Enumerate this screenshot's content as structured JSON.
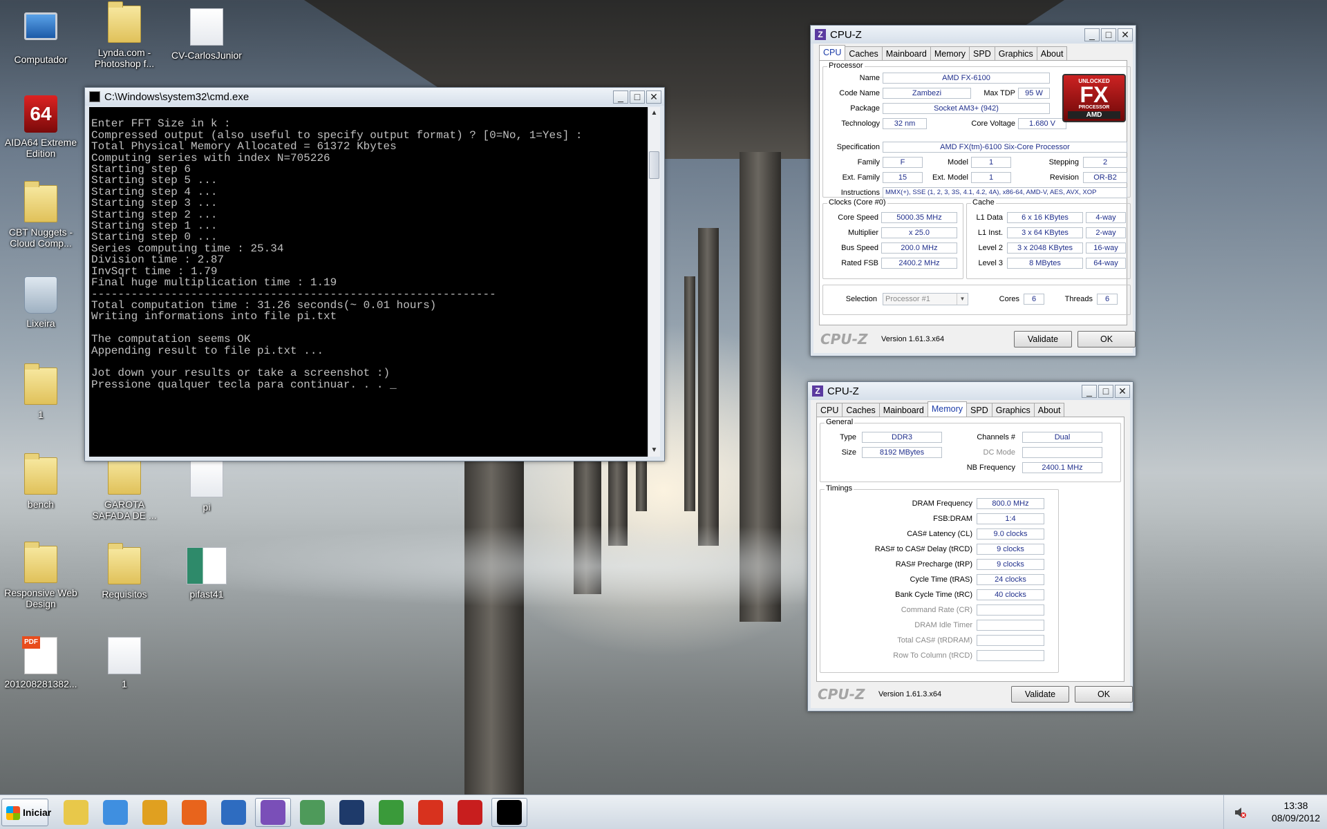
{
  "desktop": {
    "icons": [
      {
        "label": "Computador"
      },
      {
        "label": "Lynda.com - Photoshop f..."
      },
      {
        "label": "CV-CarlosJunior"
      },
      {
        "label": "AIDA64 Extreme Edition"
      },
      {
        "label": "CBT Nuggets - Cloud Comp..."
      },
      {
        "label": "Lixeira"
      },
      {
        "label": "1"
      },
      {
        "label": "bench"
      },
      {
        "label": "GAROTA SAFADA DE ..."
      },
      {
        "label": "pi"
      },
      {
        "label": "Responsive Web Design"
      },
      {
        "label": "Requisitos"
      },
      {
        "label": "pifast41"
      },
      {
        "label": "201208281382..."
      },
      {
        "label": "1"
      }
    ]
  },
  "cmd": {
    "title": "C:\\Windows\\system32\\cmd.exe",
    "lines": [
      "",
      "Enter FFT Size in k :",
      "Compressed output (also useful to specify output format) ? [0=No, 1=Yes] :",
      "Total Physical Memory Allocated = 61372 Kbytes",
      "Computing series with index N=705226",
      "Starting step 6",
      "Starting step 5 ...",
      "Starting step 4 ...",
      "Starting step 3 ...",
      "Starting step 2 ...",
      "Starting step 1 ...",
      "Starting step 0 ...",
      "Series computing time : 25.34",
      "Division time : 2.87",
      "InvSqrt time : 1.79",
      "Final huge multiplication time : 1.19",
      "-------------------------------------------------------------",
      "Total computation time : 31.26 seconds(~ 0.01 hours)",
      "Writing informations into file pi.txt",
      "",
      "The computation seems OK",
      "Appending result to file pi.txt ...",
      "",
      "Jot down your results or take a screenshot :)",
      "Pressione qualquer tecla para continuar. . . _"
    ]
  },
  "cpuz_cpu": {
    "title": "CPU-Z",
    "tabs": [
      "CPU",
      "Caches",
      "Mainboard",
      "Memory",
      "SPD",
      "Graphics",
      "About"
    ],
    "active_tab": "CPU",
    "processor_group": "Processor",
    "name_label": "Name",
    "name": "AMD FX-6100",
    "codename_label": "Code Name",
    "codename": "Zambezi",
    "maxtdp_label": "Max TDP",
    "maxtdp": "95 W",
    "package_label": "Package",
    "package": "Socket AM3+ (942)",
    "technology_label": "Technology",
    "technology": "32 nm",
    "corevoltage_label": "Core Voltage",
    "corevoltage": "1.680 V",
    "spec_label": "Specification",
    "spec": "AMD FX(tm)-6100 Six-Core Processor",
    "family_label": "Family",
    "family": "F",
    "model_label": "Model",
    "model": "1",
    "stepping_label": "Stepping",
    "stepping": "2",
    "extfamily_label": "Ext. Family",
    "extfamily": "15",
    "extmodel_label": "Ext. Model",
    "extmodel": "1",
    "revision_label": "Revision",
    "revision": "OR-B2",
    "instructions_label": "Instructions",
    "instructions": "MMX(+), SSE (1, 2, 3, 3S, 4.1, 4.2, 4A), x86-64, AMD-V, AES, AVX, XOP",
    "clocks_group": "Clocks (Core #0)",
    "corespeed_label": "Core Speed",
    "corespeed": "5000.35 MHz",
    "multiplier_label": "Multiplier",
    "multiplier": "x 25.0",
    "busspeed_label": "Bus Speed",
    "busspeed": "200.0 MHz",
    "ratedfsb_label": "Rated FSB",
    "ratedfsb": "2400.2 MHz",
    "cache_group": "Cache",
    "l1d_label": "L1 Data",
    "l1d": "6 x 16 KBytes",
    "l1d_way": "4-way",
    "l1i_label": "L1 Inst.",
    "l1i": "3 x 64 KBytes",
    "l1i_way": "2-way",
    "l2_label": "Level 2",
    "l2": "3 x 2048 KBytes",
    "l2_way": "16-way",
    "l3_label": "Level 3",
    "l3": "8 MBytes",
    "l3_way": "64-way",
    "selection_label": "Selection",
    "selection": "Processor #1",
    "cores_label": "Cores",
    "cores": "6",
    "threads_label": "Threads",
    "threads": "6",
    "logo_unlocked": "UNLOCKED",
    "logo_fx": "FX",
    "logo_processor": "PROCESSOR",
    "logo_amd": "AMD",
    "brand": "CPU-Z",
    "version": "Version 1.61.3.x64",
    "validate": "Validate",
    "ok": "OK"
  },
  "cpuz_mem": {
    "title": "CPU-Z",
    "tabs": [
      "CPU",
      "Caches",
      "Mainboard",
      "Memory",
      "SPD",
      "Graphics",
      "About"
    ],
    "active_tab": "Memory",
    "general_group": "General",
    "type_label": "Type",
    "type": "DDR3",
    "channels_label": "Channels #",
    "channels": "Dual",
    "size_label": "Size",
    "size": "8192 MBytes",
    "dcmode_label": "DC Mode",
    "dcmode": "",
    "nbfreq_label": "NB Frequency",
    "nbfreq": "2400.1 MHz",
    "timings_group": "Timings",
    "timings": [
      {
        "label": "DRAM Frequency",
        "value": "800.0 MHz",
        "dim": false
      },
      {
        "label": "FSB:DRAM",
        "value": "1:4",
        "dim": false
      },
      {
        "label": "CAS# Latency (CL)",
        "value": "9.0 clocks",
        "dim": false
      },
      {
        "label": "RAS# to CAS# Delay (tRCD)",
        "value": "9 clocks",
        "dim": false
      },
      {
        "label": "RAS# Precharge (tRP)",
        "value": "9 clocks",
        "dim": false
      },
      {
        "label": "Cycle Time (tRAS)",
        "value": "24 clocks",
        "dim": false
      },
      {
        "label": "Bank Cycle Time (tRC)",
        "value": "40 clocks",
        "dim": false
      },
      {
        "label": "Command Rate (CR)",
        "value": "",
        "dim": true
      },
      {
        "label": "DRAM Idle Timer",
        "value": "",
        "dim": true
      },
      {
        "label": "Total CAS# (tRDRAM)",
        "value": "",
        "dim": true
      },
      {
        "label": "Row To Column (tRCD)",
        "value": "",
        "dim": true
      }
    ],
    "brand": "CPU-Z",
    "version": "Version 1.61.3.x64",
    "validate": "Validate",
    "ok": "OK"
  },
  "taskbar": {
    "start_label": "Iniciar",
    "items": [
      {
        "name": "explorer-icon",
        "color": "#e8c84a",
        "open": false
      },
      {
        "name": "media-player-icon",
        "color": "#3f8fe0",
        "open": false
      },
      {
        "name": "lightning-app-icon",
        "color": "#e0a020",
        "open": false
      },
      {
        "name": "firefox-icon",
        "color": "#e8641c",
        "open": false
      },
      {
        "name": "thunderbird-icon",
        "color": "#2e6cc0",
        "open": false
      },
      {
        "name": "cpuz-icon",
        "color": "#7a4fb8",
        "open": true
      },
      {
        "name": "picture-app-icon",
        "color": "#4e9a5a",
        "open": false
      },
      {
        "name": "fan-app-icon",
        "color": "#1e3a6a",
        "open": false
      },
      {
        "name": "csharp-icon",
        "color": "#3a9a3a",
        "open": false
      },
      {
        "name": "red-app-icon",
        "color": "#d8321e",
        "open": false
      },
      {
        "name": "aida64-icon",
        "color": "#c81e1e",
        "open": false
      },
      {
        "name": "cmd-icon",
        "color": "#000000",
        "open": true
      }
    ],
    "time": "13:38",
    "date": "08/09/2012"
  }
}
